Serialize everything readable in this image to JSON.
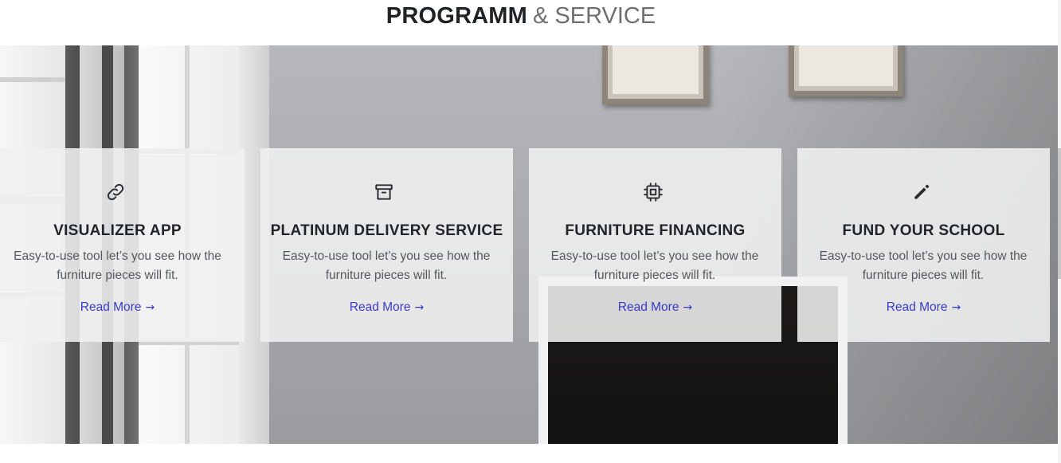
{
  "section": {
    "title_strong": "PROGRAMM",
    "title_light": "& SERVICE"
  },
  "cards": [
    {
      "icon": "link-icon",
      "title": "VISUALIZER APP",
      "description": "Easy-to-use tool let’s you see how the furniture pieces will fit.",
      "link_label": "Read More",
      "link_arrow": "→"
    },
    {
      "icon": "archive-box-icon",
      "title": "PLATINUM DELIVERY SERVICE",
      "description": "Easy-to-use tool let’s you see how the furniture pieces will fit.",
      "link_label": "Read More",
      "link_arrow": "→"
    },
    {
      "icon": "chip-icon",
      "title": "FURNITURE FINANCING",
      "description": "Easy-to-use tool let’s you see how the furniture pieces will fit.",
      "link_label": "Read More",
      "link_arrow": "→"
    },
    {
      "icon": "pencil-icon",
      "title": "FUND YOUR SCHOOL",
      "description": "Easy-to-use tool let’s you see how the furniture pieces will fit.",
      "link_label": "Read More",
      "link_arrow": "→"
    }
  ],
  "colors": {
    "heading": "#1f2326",
    "heading_light": "#6d6f73",
    "card_background": "#f0f0f0",
    "link": "#3a3ac8",
    "text": "#55585c"
  }
}
